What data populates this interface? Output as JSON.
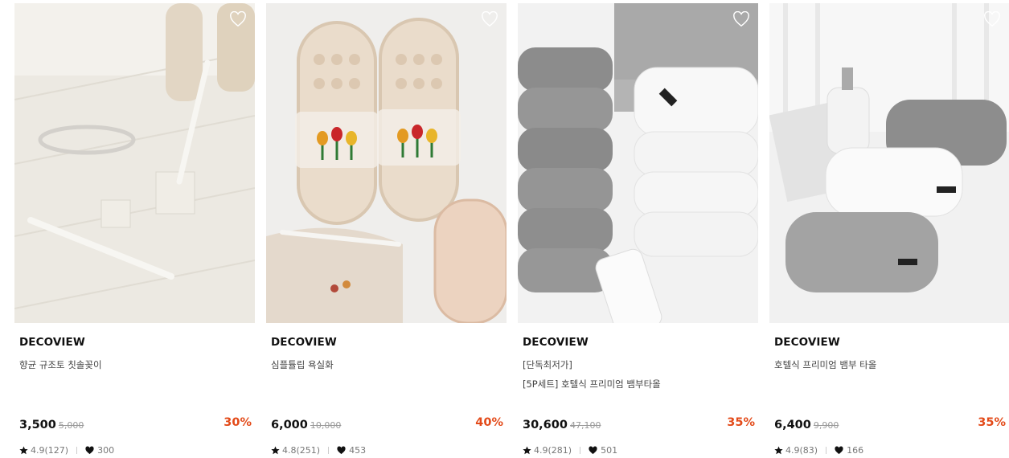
{
  "products": [
    {
      "brand": "DECOVIEW",
      "name_lines": [
        "향균 규조토 칫솔꽂이"
      ],
      "price": "3,500",
      "original_price": "5,000",
      "discount": "30%",
      "rating": "4.9(127)",
      "likes": "300",
      "image_icon": "toothbrush-holder-photo"
    },
    {
      "brand": "DECOVIEW",
      "name_lines": [
        "심플튤립 욕실화"
      ],
      "price": "6,000",
      "original_price": "10,000",
      "discount": "40%",
      "rating": "4.8(251)",
      "likes": "453",
      "image_icon": "tulip-slippers-photo"
    },
    {
      "brand": "DECOVIEW",
      "name_lines": [
        "[단독최저가]",
        "[5P세트] 호텔식 프리미엄 뱀부타올"
      ],
      "price": "30,600",
      "original_price": "47,100",
      "discount": "35%",
      "rating": "4.9(281)",
      "likes": "501",
      "image_icon": "towel-stack-photo"
    },
    {
      "brand": "DECOVIEW",
      "name_lines": [
        "호텔식 프리미엄 뱀부 타올"
      ],
      "price": "6,400",
      "original_price": "9,900",
      "discount": "35%",
      "rating": "4.9(83)",
      "likes": "166",
      "image_icon": "rolled-towels-photo"
    }
  ],
  "colors": {
    "discount": "#e34b1a",
    "brand_text": "#111111",
    "meta_text": "#777777"
  }
}
